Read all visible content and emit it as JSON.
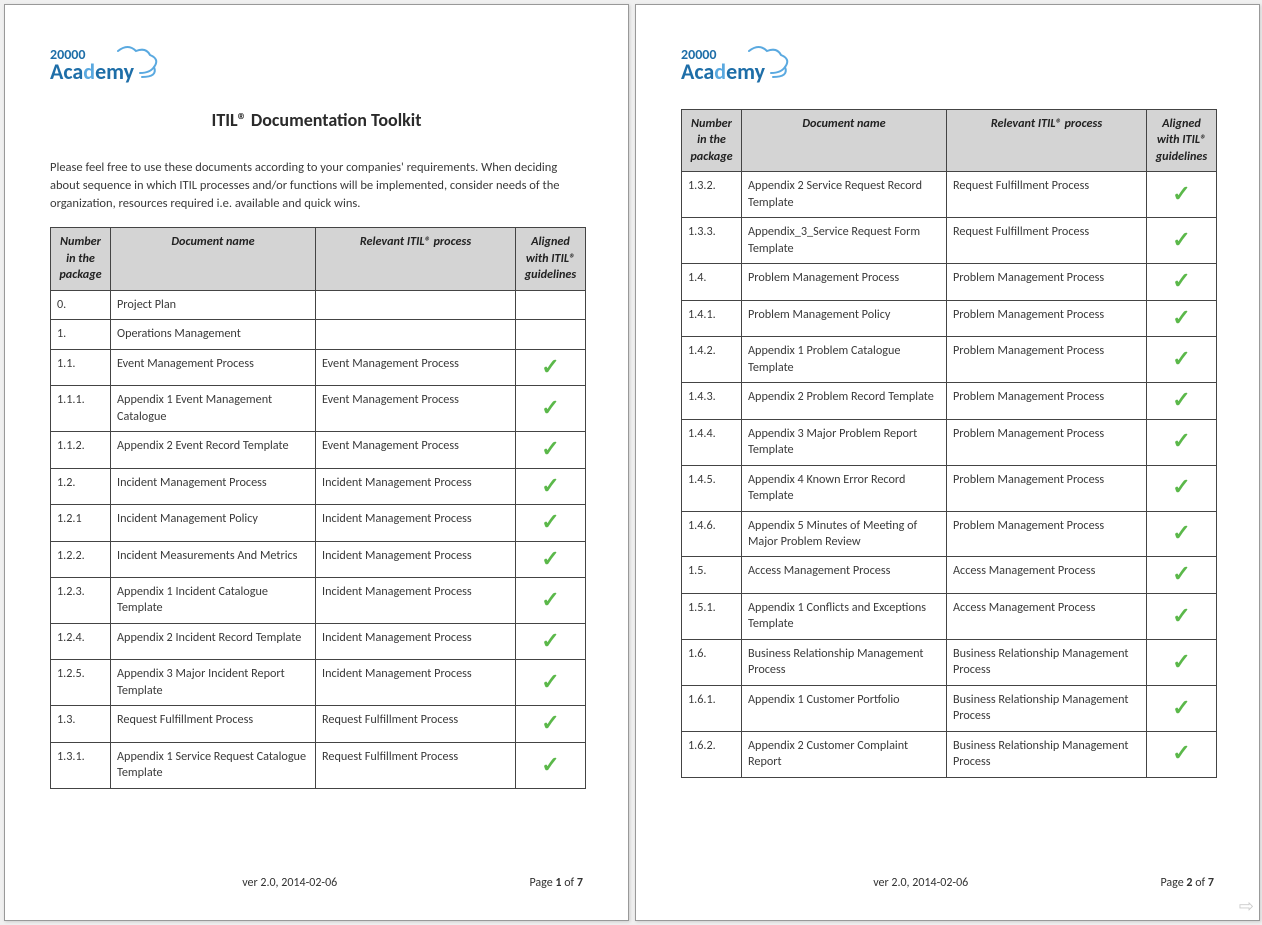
{
  "brand": {
    "num": "20000",
    "word": "Academy"
  },
  "title": "ITIL® Documentation Toolkit",
  "intro": "Please feel free to use these documents according to your companies' requirements. When deciding about sequence in which ITIL processes and/or functions will be implemented, consider needs of the organization, resources required i.e. available and quick wins.",
  "columns": {
    "num": "Number in the package",
    "doc": "Document name",
    "proc": "Relevant ITIL® process",
    "align": "Aligned with ITIL® guidelines"
  },
  "footer": {
    "version": "ver 2.0, 2014-02-06",
    "page_prefix": "Page ",
    "page_of": " of ",
    "total": "7"
  },
  "pages": [
    {
      "page_num": "1",
      "show_title": true,
      "show_intro": true,
      "rows": [
        {
          "num": "0.",
          "doc": "Project Plan",
          "proc": "",
          "check": false
        },
        {
          "num": "1.",
          "doc": "Operations Management",
          "proc": "",
          "check": false
        },
        {
          "num": "1.1.",
          "doc": "Event Management Process",
          "proc": "Event Management Process",
          "check": true
        },
        {
          "num": "1.1.1.",
          "doc": "Appendix 1 Event Management Catalogue",
          "proc": "Event Management Process",
          "check": true
        },
        {
          "num": "1.1.2.",
          "doc": "Appendix 2 Event Record Template",
          "proc": "Event Management Process",
          "check": true
        },
        {
          "num": "1.2.",
          "doc": "Incident Management Process",
          "proc": "Incident Management Process",
          "check": true
        },
        {
          "num": "1.2.1",
          "doc": "Incident Management Policy",
          "proc": "Incident Management Process",
          "check": true
        },
        {
          "num": "1.2.2.",
          "doc": "Incident Measurements And Metrics",
          "proc": "Incident Management Process",
          "check": true
        },
        {
          "num": "1.2.3.",
          "doc": "Appendix 1 Incident Catalogue Template",
          "proc": "Incident Management Process",
          "check": true
        },
        {
          "num": "1.2.4.",
          "doc": "Appendix 2 Incident Record Template",
          "proc": "Incident Management Process",
          "check": true
        },
        {
          "num": "1.2.5.",
          "doc": "Appendix 3 Major Incident Report Template",
          "proc": "Incident Management Process",
          "check": true
        },
        {
          "num": "1.3.",
          "doc": "Request Fulfillment Process",
          "proc": "Request Fulfillment Process",
          "check": true
        },
        {
          "num": "1.3.1.",
          "doc": "Appendix 1 Service Request Catalogue Template",
          "proc": "Request Fulfillment Process",
          "check": true
        }
      ]
    },
    {
      "page_num": "2",
      "show_title": false,
      "show_intro": false,
      "rows": [
        {
          "num": "1.3.2.",
          "doc": "Appendix 2 Service Request Record Template",
          "proc": "Request Fulfillment Process",
          "check": true
        },
        {
          "num": "1.3.3.",
          "doc": "Appendix_3_Service Request Form Template",
          "proc": "Request Fulfillment Process",
          "check": true
        },
        {
          "num": "1.4.",
          "doc": "Problem Management Process",
          "proc": "Problem Management Process",
          "check": true
        },
        {
          "num": "1.4.1.",
          "doc": "Problem Management Policy",
          "proc": "Problem Management Process",
          "check": true
        },
        {
          "num": "1.4.2.",
          "doc": "Appendix 1 Problem Catalogue Template",
          "proc": "Problem Management Process",
          "check": true
        },
        {
          "num": "1.4.3.",
          "doc": "Appendix 2 Problem Record Template",
          "proc": "Problem Management Process",
          "check": true
        },
        {
          "num": "1.4.4.",
          "doc": "Appendix 3 Major Problem Report Template",
          "proc": "Problem Management Process",
          "check": true
        },
        {
          "num": "1.4.5.",
          "doc": "Appendix 4 Known Error Record Template",
          "proc": "Problem Management Process",
          "check": true
        },
        {
          "num": "1.4.6.",
          "doc": "Appendix 5 Minutes of Meeting of Major Problem Review",
          "proc": "Problem Management Process",
          "check": true
        },
        {
          "num": "1.5.",
          "doc": "Access Management Process",
          "proc": "Access Management Process",
          "check": true
        },
        {
          "num": "1.5.1.",
          "doc": "Appendix 1 Conflicts and Exceptions Template",
          "proc": "Access Management Process",
          "check": true
        },
        {
          "num": "1.6.",
          "doc": "Business Relationship Management Process",
          "proc": "Business Relationship Management Process",
          "check": true
        },
        {
          "num": "1.6.1.",
          "doc": "Appendix 1 Customer Portfolio",
          "proc": "Business Relationship Management Process",
          "check": true
        },
        {
          "num": "1.6.2.",
          "doc": "Appendix 2 Customer Complaint Report",
          "proc": "Business Relationship Management Process",
          "check": true
        }
      ]
    }
  ]
}
